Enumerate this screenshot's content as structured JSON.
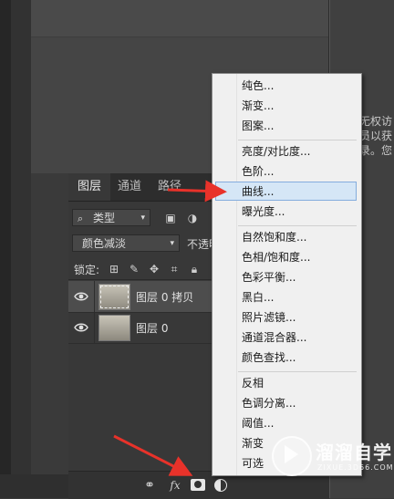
{
  "right_panel": {
    "lines": [
      "无权访",
      "员以获",
      "录。您"
    ]
  },
  "layers_panel": {
    "tabs": [
      {
        "label": "图层",
        "active": true
      },
      {
        "label": "通道",
        "active": false
      },
      {
        "label": "路径",
        "active": false
      }
    ],
    "filter_select": "类型",
    "blend_mode": "颜色减淡",
    "opacity_label": "不透明",
    "lock_label": "锁定:",
    "layers": [
      {
        "name": "图层 0 拷贝",
        "visible": true,
        "selected": true
      },
      {
        "name": "图层 0",
        "visible": true,
        "selected": false
      }
    ],
    "footer": {
      "link_icon": "link-icon",
      "fx_label": "fx",
      "mask_icon": "mask-icon",
      "adjustment_icon": "adjustment-icon"
    }
  },
  "menu": {
    "highlight_color": "#d5e6f6",
    "groups": [
      [
        "纯色...",
        "渐变...",
        "图案..."
      ],
      [
        "亮度/对比度...",
        "色阶...",
        "曲线...",
        "曝光度..."
      ],
      [
        "自然饱和度...",
        "色相/饱和度...",
        "色彩平衡...",
        "黑白...",
        "照片滤镜...",
        "通道混合器...",
        "颜色查找..."
      ],
      [
        "反相",
        "色调分离...",
        "阈值...",
        "渐变映射...",
        "可选颜色..."
      ]
    ],
    "highlighted_item": "曲线...",
    "visible_tail": {
      "gradient_map": "渐变",
      "selective_color": "可选"
    }
  },
  "annotation": {
    "arrow_color": "#e8322a"
  },
  "watermark": {
    "title": "溜溜自学",
    "subtitle": "ZIXUE.3D66.COM"
  }
}
